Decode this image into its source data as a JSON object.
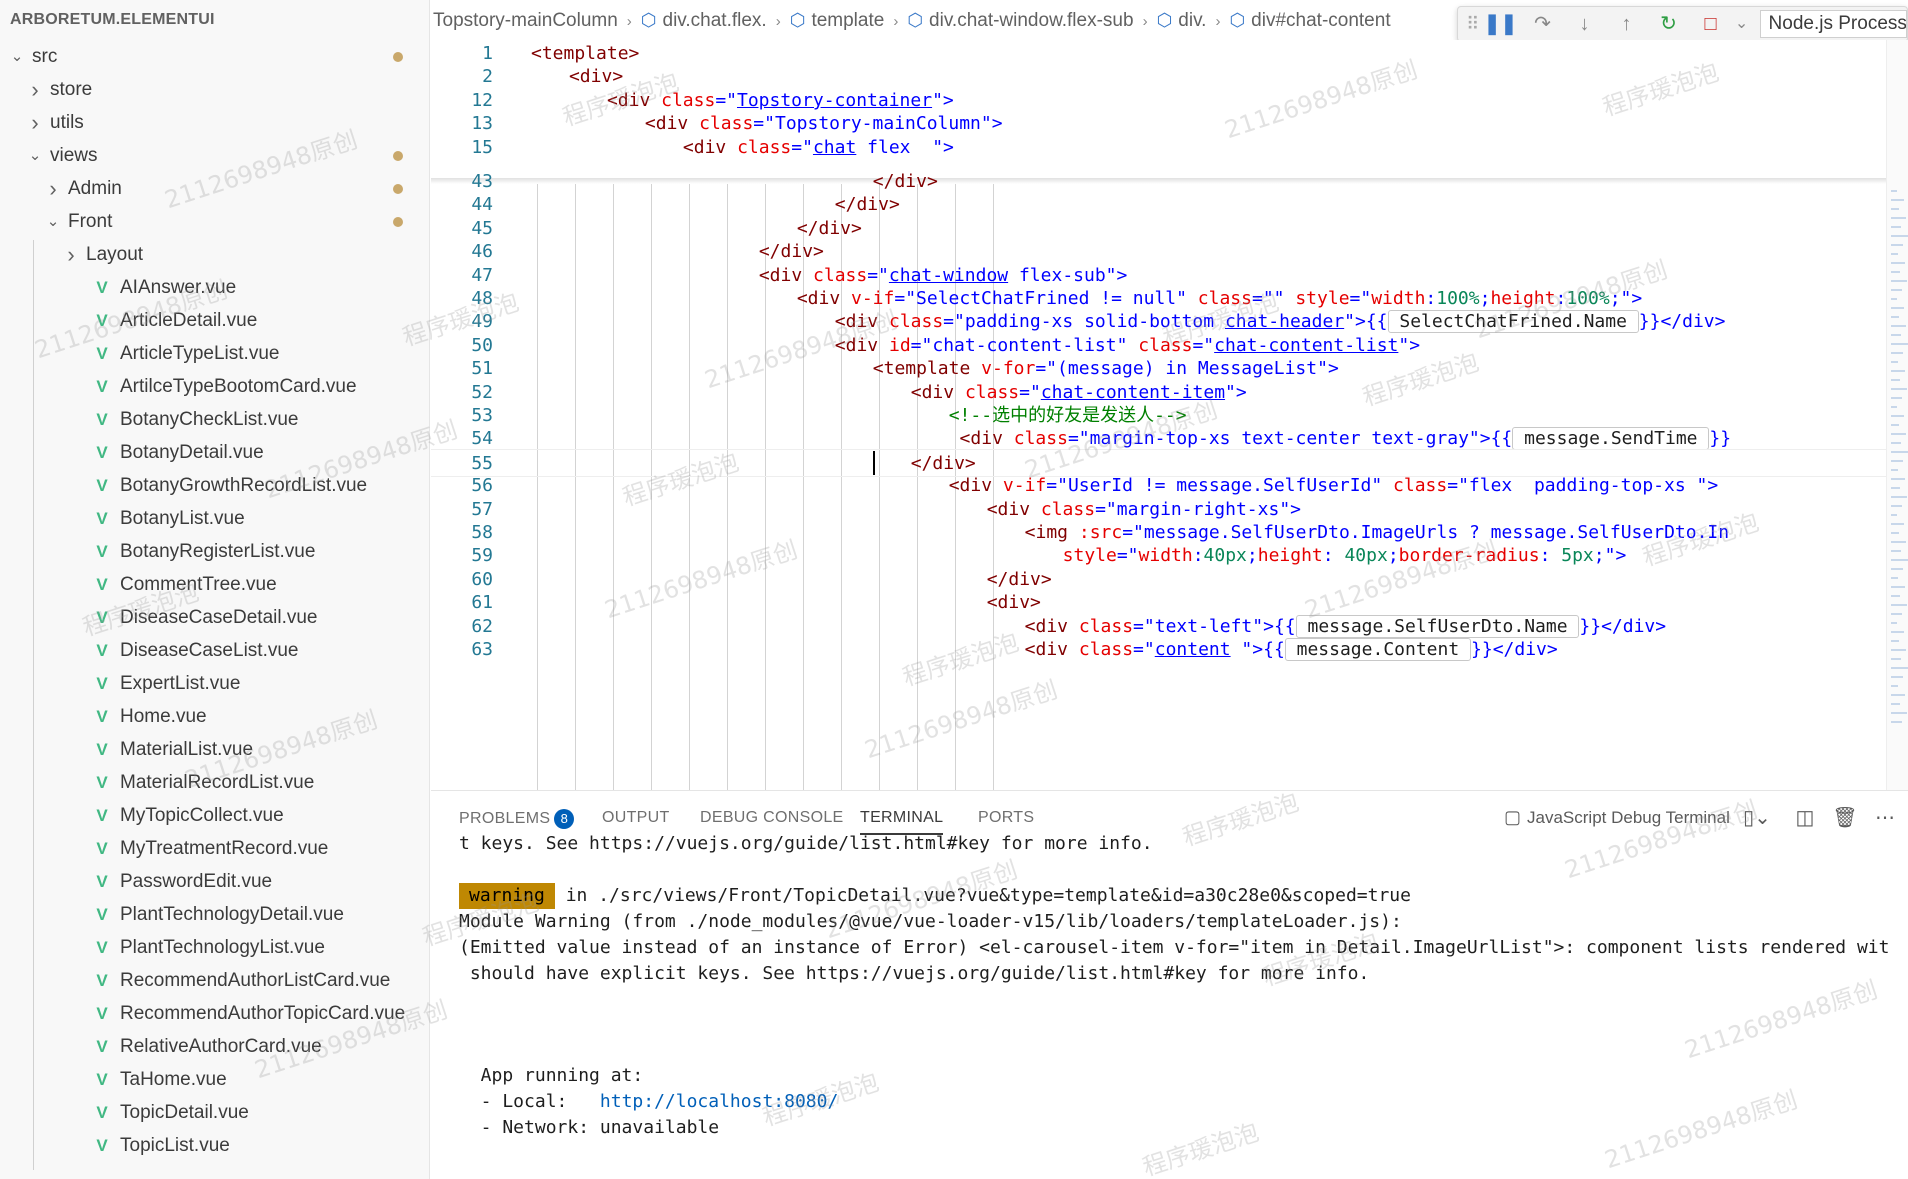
{
  "sidebar": {
    "title": "ARBORETUM.ELEMENTUI",
    "items": [
      {
        "label": "src",
        "kind": "folder-open",
        "depth": 0,
        "dot": true
      },
      {
        "label": "store",
        "kind": "folder",
        "depth": 1,
        "dot": false
      },
      {
        "label": "utils",
        "kind": "folder",
        "depth": 1,
        "dot": false
      },
      {
        "label": "views",
        "kind": "folder-open",
        "depth": 1,
        "dot": true
      },
      {
        "label": "Admin",
        "kind": "folder",
        "depth": 2,
        "dot": true
      },
      {
        "label": "Front",
        "kind": "folder-open",
        "depth": 2,
        "dot": true
      },
      {
        "label": "Layout",
        "kind": "folder",
        "depth": 3,
        "dot": false
      },
      {
        "label": "AIAnswer.vue",
        "kind": "vue",
        "depth": 3,
        "dot": false
      },
      {
        "label": "ArticleDetail.vue",
        "kind": "vue",
        "depth": 3,
        "dot": false
      },
      {
        "label": "ArticleTypeList.vue",
        "kind": "vue",
        "depth": 3,
        "dot": false
      },
      {
        "label": "ArtilceTypeBootomCard.vue",
        "kind": "vue",
        "depth": 3,
        "dot": false
      },
      {
        "label": "BotanyCheckList.vue",
        "kind": "vue",
        "depth": 3,
        "dot": false
      },
      {
        "label": "BotanyDetail.vue",
        "kind": "vue",
        "depth": 3,
        "dot": false
      },
      {
        "label": "BotanyGrowthRecordList.vue",
        "kind": "vue",
        "depth": 3,
        "dot": false
      },
      {
        "label": "BotanyList.vue",
        "kind": "vue",
        "depth": 3,
        "dot": false
      },
      {
        "label": "BotanyRegisterList.vue",
        "kind": "vue",
        "depth": 3,
        "dot": false
      },
      {
        "label": "CommentTree.vue",
        "kind": "vue",
        "depth": 3,
        "dot": false
      },
      {
        "label": "DiseaseCaseDetail.vue",
        "kind": "vue",
        "depth": 3,
        "dot": false
      },
      {
        "label": "DiseaseCaseList.vue",
        "kind": "vue",
        "depth": 3,
        "dot": false
      },
      {
        "label": "ExpertList.vue",
        "kind": "vue",
        "depth": 3,
        "dot": false
      },
      {
        "label": "Home.vue",
        "kind": "vue",
        "depth": 3,
        "dot": false
      },
      {
        "label": "MaterialList.vue",
        "kind": "vue",
        "depth": 3,
        "dot": false
      },
      {
        "label": "MaterialRecordList.vue",
        "kind": "vue",
        "depth": 3,
        "dot": false
      },
      {
        "label": "MyTopicCollect.vue",
        "kind": "vue",
        "depth": 3,
        "dot": false
      },
      {
        "label": "MyTreatmentRecord.vue",
        "kind": "vue",
        "depth": 3,
        "dot": false
      },
      {
        "label": "PasswordEdit.vue",
        "kind": "vue",
        "depth": 3,
        "dot": false
      },
      {
        "label": "PlantTechnologyDetail.vue",
        "kind": "vue",
        "depth": 3,
        "dot": false
      },
      {
        "label": "PlantTechnologyList.vue",
        "kind": "vue",
        "depth": 3,
        "dot": false
      },
      {
        "label": "RecommendAuthorListCard.vue",
        "kind": "vue",
        "depth": 3,
        "dot": false
      },
      {
        "label": "RecommendAuthorTopicCard.vue",
        "kind": "vue",
        "depth": 3,
        "dot": false
      },
      {
        "label": "RelativeAuthorCard.vue",
        "kind": "vue",
        "depth": 3,
        "dot": false
      },
      {
        "label": "TaHome.vue",
        "kind": "vue",
        "depth": 3,
        "dot": false
      },
      {
        "label": "TopicDetail.vue",
        "kind": "vue",
        "depth": 3,
        "dot": false
      },
      {
        "label": "TopicList.vue",
        "kind": "vue",
        "depth": 3,
        "dot": false
      }
    ]
  },
  "breadcrumb": {
    "items": [
      "Topstory-mainColumn",
      "div.chat.flex.",
      "template",
      "div.chat-window.flex-sub",
      "div.",
      "div#chat-content"
    ]
  },
  "debug_toolbar": {
    "grip_icon": "grip-icon",
    "buttons": [
      {
        "name": "pause",
        "glyph": "❚❚",
        "color": "blue"
      },
      {
        "name": "step-over",
        "glyph": "↷",
        "color": "gray"
      },
      {
        "name": "step-into",
        "glyph": "↓",
        "color": "gray"
      },
      {
        "name": "step-out",
        "glyph": "↑",
        "color": "gray"
      },
      {
        "name": "restart",
        "glyph": "↻",
        "color": "green"
      },
      {
        "name": "stop",
        "glyph": "□",
        "color": "red"
      },
      {
        "name": "stop-menu",
        "glyph": "⌄",
        "color": "gray"
      }
    ],
    "process_select": "Node.js Process"
  },
  "editor": {
    "cursor_line": 55,
    "lines": [
      {
        "num": "1",
        "indent": 0,
        "segs": [
          [
            "<template>",
            "tag"
          ]
        ]
      },
      {
        "num": "2",
        "indent": 1,
        "segs": [
          [
            "<div>",
            "tag"
          ]
        ]
      },
      {
        "num": "12",
        "indent": 2,
        "segs": [
          [
            "<div ",
            "tag"
          ],
          [
            "class",
            "attr"
          ],
          [
            "=\"",
            "plain"
          ],
          [
            "Topstory-container",
            "linkval"
          ],
          [
            "\">",
            "plain"
          ]
        ]
      },
      {
        "num": "13",
        "indent": 3,
        "segs": [
          [
            "<div ",
            "tag"
          ],
          [
            "class",
            "attr"
          ],
          [
            "=\"",
            "plain"
          ],
          [
            "Topstory-mainColumn",
            "val"
          ],
          [
            "\">",
            "plain"
          ]
        ]
      },
      {
        "num": "15",
        "indent": 4,
        "segs": [
          [
            "<div ",
            "tag"
          ],
          [
            "class",
            "attr"
          ],
          [
            "=\"",
            "plain"
          ],
          [
            "chat",
            "linkval"
          ],
          [
            " ",
            "val"
          ],
          [
            "flex",
            "val"
          ],
          [
            "  ",
            "val"
          ],
          [
            "\">",
            "plain"
          ]
        ]
      },
      {
        "num": "43",
        "indent": 9,
        "segs": [
          [
            "</div>",
            "tag"
          ]
        ]
      },
      {
        "num": "44",
        "indent": 8,
        "segs": [
          [
            "</div>",
            "tag"
          ]
        ]
      },
      {
        "num": "45",
        "indent": 7,
        "segs": [
          [
            "</div>",
            "tag"
          ]
        ]
      },
      {
        "num": "46",
        "indent": 6,
        "segs": [
          [
            "</div>",
            "tag"
          ]
        ]
      },
      {
        "num": "47",
        "indent": 6,
        "segs": [
          [
            "<div ",
            "tag"
          ],
          [
            "class",
            "attr"
          ],
          [
            "=\"",
            "plain"
          ],
          [
            "chat-window",
            "linkval"
          ],
          [
            " ",
            "val"
          ],
          [
            "flex-sub",
            "val"
          ],
          [
            "\">",
            "plain"
          ]
        ]
      },
      {
        "num": "48",
        "indent": 7,
        "segs": [
          [
            "<div ",
            "tag"
          ],
          [
            "v-if",
            "attr"
          ],
          [
            "=\"SelectChatFrined != null\" ",
            "plain"
          ],
          [
            "class",
            "attr"
          ],
          [
            "=\"\" ",
            "plain"
          ],
          [
            "style",
            "attr"
          ],
          [
            "=\"",
            "plain"
          ],
          [
            "width",
            "attr"
          ],
          [
            ":",
            "plain"
          ],
          [
            "100%",
            "num"
          ],
          [
            ";",
            "plain"
          ],
          [
            "height",
            "attr"
          ],
          [
            ":",
            "plain"
          ],
          [
            "100%",
            "num"
          ],
          [
            ";\">",
            "plain"
          ]
        ]
      },
      {
        "num": "49",
        "indent": 8,
        "segs": [
          [
            "<div ",
            "tag"
          ],
          [
            "class",
            "attr"
          ],
          [
            "=\"",
            "plain"
          ],
          [
            "padding-xs solid-bottom ",
            "val"
          ],
          [
            "chat-header",
            "linkval"
          ],
          [
            "\">{{",
            "plain"
          ],
          [
            " SelectChatFrined.Name ",
            "box"
          ],
          [
            "}}</div>",
            "plain"
          ]
        ]
      },
      {
        "num": "50",
        "indent": 8,
        "segs": [
          [
            "<div ",
            "tag"
          ],
          [
            "id",
            "attr"
          ],
          [
            "=\"",
            "plain"
          ],
          [
            "chat-content-list",
            "val"
          ],
          [
            "\" ",
            "plain"
          ],
          [
            "class",
            "attr"
          ],
          [
            "=\"",
            "plain"
          ],
          [
            "chat-content-list",
            "linkval"
          ],
          [
            "\">",
            "plain"
          ]
        ]
      },
      {
        "num": "51",
        "indent": 9,
        "segs": [
          [
            "<template ",
            "tag"
          ],
          [
            "v-for",
            "attr"
          ],
          [
            "=\"",
            "plain"
          ],
          [
            "(message) in MessageList",
            "plain"
          ],
          [
            "\">",
            "plain"
          ]
        ]
      },
      {
        "num": "52",
        "indent": 10,
        "segs": [
          [
            "<div ",
            "tag"
          ],
          [
            "class",
            "attr"
          ],
          [
            "=\"",
            "plain"
          ],
          [
            "chat-content-item",
            "linkval"
          ],
          [
            "\">",
            "plain"
          ]
        ]
      },
      {
        "num": "53",
        "indent": 11,
        "segs": [
          [
            "<!--选中的好友是发送人-->",
            "comment"
          ]
        ]
      },
      {
        "num": "54",
        "indent": 11,
        "segs": [
          [
            " <div ",
            "tag"
          ],
          [
            "class",
            "attr"
          ],
          [
            "=\"",
            "plain"
          ],
          [
            "margin-top-xs text-center text-gray",
            "val"
          ],
          [
            "\">{{",
            "plain"
          ],
          [
            " message.SendTime ",
            "box"
          ],
          [
            "}}",
            "plain"
          ]
        ]
      },
      {
        "num": "55",
        "indent": 10,
        "segs": [
          [
            "</div>",
            "tag"
          ]
        ]
      },
      {
        "num": "56",
        "indent": 11,
        "segs": [
          [
            "<div ",
            "tag"
          ],
          [
            "v-if",
            "attr"
          ],
          [
            "=\"UserId != message.SelfUserId\" ",
            "plain"
          ],
          [
            "class",
            "attr"
          ],
          [
            "=\"",
            "plain"
          ],
          [
            "flex  padding-top-xs ",
            "val"
          ],
          [
            "\">",
            "plain"
          ]
        ]
      },
      {
        "num": "57",
        "indent": 12,
        "segs": [
          [
            "<div ",
            "tag"
          ],
          [
            "class",
            "attr"
          ],
          [
            "=\"",
            "plain"
          ],
          [
            "margin-right-xs",
            "val"
          ],
          [
            "\">",
            "plain"
          ]
        ]
      },
      {
        "num": "58",
        "indent": 13,
        "segs": [
          [
            "<img ",
            "tag"
          ],
          [
            ":src",
            "attr"
          ],
          [
            "=\"message.SelfUserDto.ImageUrls ? message.SelfUserDto.In",
            "plain"
          ]
        ]
      },
      {
        "num": "59",
        "indent": 14,
        "segs": [
          [
            "style",
            "attr"
          ],
          [
            "=\"",
            "plain"
          ],
          [
            "width",
            "attr"
          ],
          [
            ":",
            "plain"
          ],
          [
            "40px",
            "num"
          ],
          [
            ";",
            "plain"
          ],
          [
            "height",
            "attr"
          ],
          [
            ": ",
            "plain"
          ],
          [
            "40px",
            "num"
          ],
          [
            ";",
            "plain"
          ],
          [
            "border-radius",
            "attr"
          ],
          [
            ": ",
            "plain"
          ],
          [
            "5px",
            "num"
          ],
          [
            ";\">",
            "plain"
          ]
        ]
      },
      {
        "num": "60",
        "indent": 12,
        "segs": [
          [
            "</div>",
            "tag"
          ]
        ]
      },
      {
        "num": "61",
        "indent": 12,
        "segs": [
          [
            "<div>",
            "tag"
          ]
        ]
      },
      {
        "num": "62",
        "indent": 13,
        "segs": [
          [
            "<div ",
            "tag"
          ],
          [
            "class",
            "attr"
          ],
          [
            "=\"",
            "plain"
          ],
          [
            "text-left",
            "val"
          ],
          [
            "\">{{",
            "plain"
          ],
          [
            " message.SelfUserDto.Name ",
            "box"
          ],
          [
            "}}</div>",
            "plain"
          ]
        ]
      },
      {
        "num": "63",
        "indent": 13,
        "segs": [
          [
            "<div ",
            "tag"
          ],
          [
            "class",
            "attr"
          ],
          [
            "=\"",
            "plain"
          ],
          [
            "content",
            "linkval"
          ],
          [
            " \">{{",
            "plain"
          ],
          [
            " message.Content ",
            "box"
          ],
          [
            "}}</div>",
            "plain"
          ]
        ]
      }
    ]
  },
  "panel": {
    "tabs": [
      {
        "label": "PROBLEMS",
        "badge": "8",
        "active": false
      },
      {
        "label": "OUTPUT",
        "badge": "",
        "active": false
      },
      {
        "label": "DEBUG CONSOLE",
        "badge": "",
        "active": false
      },
      {
        "label": "TERMINAL",
        "badge": "",
        "active": true
      },
      {
        "label": "PORTS",
        "badge": "",
        "active": false
      }
    ],
    "terminal_select": "JavaScript Debug Terminal",
    "terminal_lines": [
      "t keys. See https://vuejs.org/guide/list.html#key for more info.",
      "",
      "",
      "Module Warning (from ./node_modules/@vue/vue-loader-v15/lib/loaders/templateLoader.js):",
      "(Emitted value instead of an instance of Error) <el-carousel-item v-for=\"item in Detail.ImageUrlList\">: component lists rendered wit",
      " should have explicit keys. See https://vuejs.org/guide/list.html#key for more info.",
      "",
      "",
      "  App running at:",
      "  - Local:   ",
      "  - Network: unavailable"
    ],
    "warning_label": "warning",
    "warning_text": " in ./src/views/Front/TopicDetail.vue?vue&type=template&id=a30c28e0&scoped=true",
    "local_url": "http://localhost:8080/"
  },
  "watermarks": [
    "2112698948原创",
    "程序瑗泡泡"
  ],
  "colors": {
    "tag": "#800000",
    "attr": "#e50000",
    "value": "#0000ff",
    "comment": "#008000",
    "line_number": "#237893",
    "vue_icon": "#41b883",
    "badge": "#005fb8",
    "warning_bg": "#bf8803",
    "modified_dot": "#c9a86b"
  }
}
